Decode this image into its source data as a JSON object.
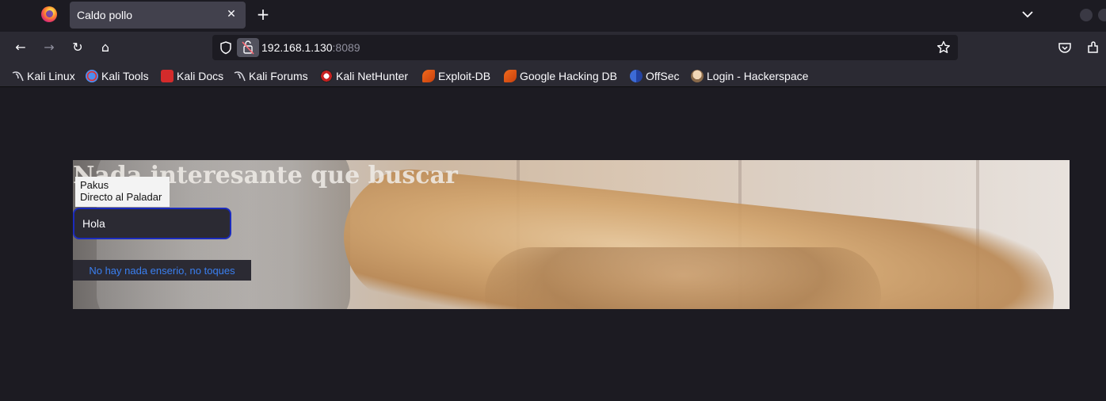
{
  "browser": {
    "tab": {
      "title": "Caldo pollo",
      "close_glyph": "✕"
    },
    "new_tab_glyph": "+",
    "url": {
      "host": "192.168.1.130",
      "port": ":8089"
    },
    "nav_icons": {
      "back": "←",
      "forward": "→",
      "reload": "↻",
      "home": "⌂"
    },
    "bookmarks": [
      {
        "label": "Kali Linux",
        "icon": "kali-dragon-icon"
      },
      {
        "label": "Kali Tools",
        "icon": "kali-tools-icon"
      },
      {
        "label": "Kali Docs",
        "icon": "kali-docs-icon"
      },
      {
        "label": "Kali Forums",
        "icon": "kali-dragon-icon"
      },
      {
        "label": "Kali NetHunter",
        "icon": "nethunter-icon"
      },
      {
        "label": "Exploit-DB",
        "icon": "exploit-db-icon"
      },
      {
        "label": "Google Hacking DB",
        "icon": "exploit-db-icon"
      },
      {
        "label": "OffSec",
        "icon": "offsec-icon"
      },
      {
        "label": "Login - Hackerspace",
        "icon": "hackerspace-icon"
      }
    ]
  },
  "page": {
    "hero_title": "Nada interesante que buscar",
    "brand": {
      "line1": "Pakus",
      "line2": "Directo al Paladar"
    },
    "input": {
      "value": "Hola"
    },
    "link": {
      "label": "No hay nada enserio, no toques"
    }
  },
  "colors": {
    "accent_link": "#3a7ff0",
    "input_border": "#1b2bbd",
    "chrome_bg": "#2b2a33",
    "page_bg": "#1c1b22"
  }
}
